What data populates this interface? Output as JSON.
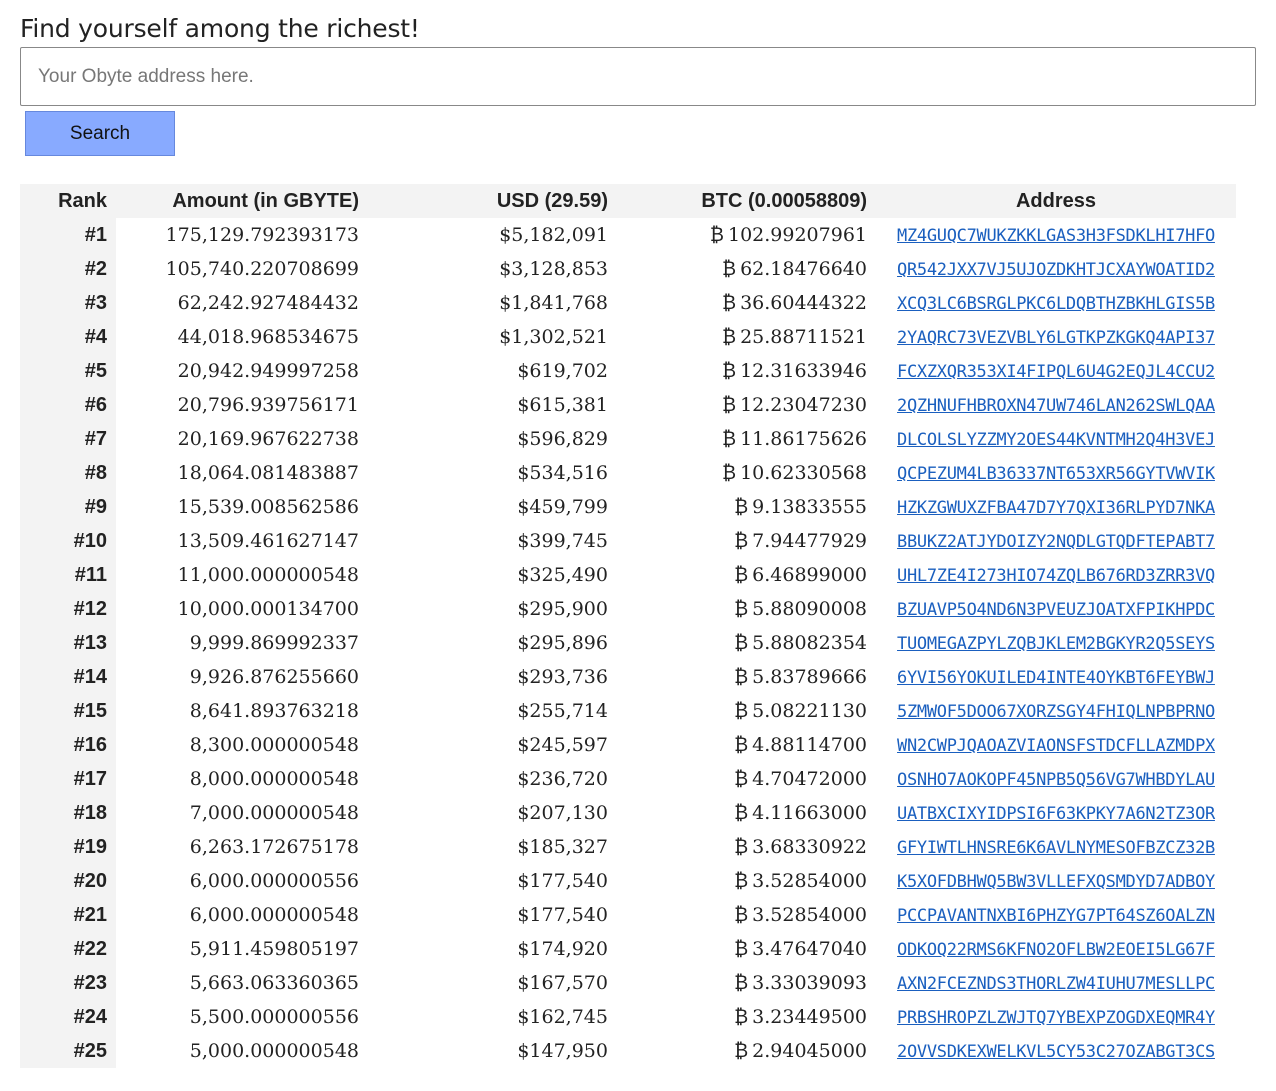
{
  "page": {
    "heading": "Find yourself among the richest!"
  },
  "search": {
    "placeholder": "Your Obyte address here.",
    "value": "",
    "button_label": "Search"
  },
  "table": {
    "columns": [
      "Rank",
      "Amount (in GBYTE)",
      "USD (29.59)",
      "BTC (0.00058809)",
      "Address"
    ],
    "btc_symbol": "₿",
    "rows": [
      {
        "rank": "#1",
        "amount": "175,129.792393173",
        "usd": "$5,182,091",
        "btc": "102.99207961",
        "address": "MZ4GUQC7WUKZKKLGAS3H3FSDKLHI7HFO"
      },
      {
        "rank": "#2",
        "amount": "105,740.220708699",
        "usd": "$3,128,853",
        "btc": "62.18476640",
        "address": "QR542JXX7VJ5UJOZDKHTJCXAYWOATID2"
      },
      {
        "rank": "#3",
        "amount": "62,242.927484432",
        "usd": "$1,841,768",
        "btc": "36.60444322",
        "address": "XCQ3LC6BSRGLPKC6LDQBTHZBKHLGIS5B"
      },
      {
        "rank": "#4",
        "amount": "44,018.968534675",
        "usd": "$1,302,521",
        "btc": "25.88711521",
        "address": "2YAQRC73VEZVBLY6LGTKPZKGKQ4API37"
      },
      {
        "rank": "#5",
        "amount": "20,942.949997258",
        "usd": "$619,702",
        "btc": "12.31633946",
        "address": "FCXZXQR353XI4FIPQL6U4G2EQJL4CCU2"
      },
      {
        "rank": "#6",
        "amount": "20,796.939756171",
        "usd": "$615,381",
        "btc": "12.23047230",
        "address": "2QZHNUFHBROXN47UW746LAN262SWLQAA"
      },
      {
        "rank": "#7",
        "amount": "20,169.967622738",
        "usd": "$596,829",
        "btc": "11.86175626",
        "address": "DLCOLSLYZZMY2OES44KVNTMH2Q4H3VEJ"
      },
      {
        "rank": "#8",
        "amount": "18,064.081483887",
        "usd": "$534,516",
        "btc": "10.62330568",
        "address": "QCPEZUM4LB36337NT653XR56GYTVWVIK"
      },
      {
        "rank": "#9",
        "amount": "15,539.008562586",
        "usd": "$459,799",
        "btc": "9.13833555",
        "address": "HZKZGWUXZFBA47D7Y7QXI36RLPYD7NKA"
      },
      {
        "rank": "#10",
        "amount": "13,509.461627147",
        "usd": "$399,745",
        "btc": "7.94477929",
        "address": "BBUKZ2ATJYDOIZY2NQDLGTQDFTEPABT7"
      },
      {
        "rank": "#11",
        "amount": "11,000.000000548",
        "usd": "$325,490",
        "btc": "6.46899000",
        "address": "UHL7ZE4I273HIO74ZQLB676RD3ZRR3VQ"
      },
      {
        "rank": "#12",
        "amount": "10,000.000134700",
        "usd": "$295,900",
        "btc": "5.88090008",
        "address": "BZUAVP5O4ND6N3PVEUZJOATXFPIKHPDC"
      },
      {
        "rank": "#13",
        "amount": "9,999.869992337",
        "usd": "$295,896",
        "btc": "5.88082354",
        "address": "TUOMEGAZPYLZQBJKLEM2BGKYR2Q5SEYS"
      },
      {
        "rank": "#14",
        "amount": "9,926.876255660",
        "usd": "$293,736",
        "btc": "5.83789666",
        "address": "6YVI56YOKUILED4INTE4OYKBT6FEYBWJ"
      },
      {
        "rank": "#15",
        "amount": "8,641.893763218",
        "usd": "$255,714",
        "btc": "5.08221130",
        "address": "5ZMWOF5DOO67XORZSGY4FHIQLNPBPRNO"
      },
      {
        "rank": "#16",
        "amount": "8,300.000000548",
        "usd": "$245,597",
        "btc": "4.88114700",
        "address": "WN2CWPJQAOAZVIAONSFSTDCFLLAZMDPX"
      },
      {
        "rank": "#17",
        "amount": "8,000.000000548",
        "usd": "$236,720",
        "btc": "4.70472000",
        "address": "OSNHO7AOKOPF45NPB5Q56VG7WHBDYLAU"
      },
      {
        "rank": "#18",
        "amount": "7,000.000000548",
        "usd": "$207,130",
        "btc": "4.11663000",
        "address": "UATBXCIXYIDPSI6F63KPKY7A6N2TZ3OR"
      },
      {
        "rank": "#19",
        "amount": "6,263.172675178",
        "usd": "$185,327",
        "btc": "3.68330922",
        "address": "GFYIWTLHNSRE6K6AVLNYMESOFBZCZ32B"
      },
      {
        "rank": "#20",
        "amount": "6,000.000000556",
        "usd": "$177,540",
        "btc": "3.52854000",
        "address": "K5XOFDBHWQ5BW3VLLEFXQSMDYD7ADBOY"
      },
      {
        "rank": "#21",
        "amount": "6,000.000000548",
        "usd": "$177,540",
        "btc": "3.52854000",
        "address": "PCCPAVANTNXBI6PHZYG7PT64SZ6OALZN"
      },
      {
        "rank": "#22",
        "amount": "5,911.459805197",
        "usd": "$174,920",
        "btc": "3.47647040",
        "address": "ODKOQ22RMS6KFNO2OFLBW2EOEI5LG67F"
      },
      {
        "rank": "#23",
        "amount": "5,663.063360365",
        "usd": "$167,570",
        "btc": "3.33039093",
        "address": "AXN2FCEZNDS3THORLZW4IUHU7MESLLPC"
      },
      {
        "rank": "#24",
        "amount": "5,500.000000556",
        "usd": "$162,745",
        "btc": "3.23449500",
        "address": "PRBSHROPZLZWJTQ7YBEXPZOGDXEQMR4Y"
      },
      {
        "rank": "#25",
        "amount": "5,000.000000548",
        "usd": "$147,950",
        "btc": "2.94045000",
        "address": "2OVVSDKEXWELKVL5CY53C27OZABGT3CS"
      }
    ]
  }
}
